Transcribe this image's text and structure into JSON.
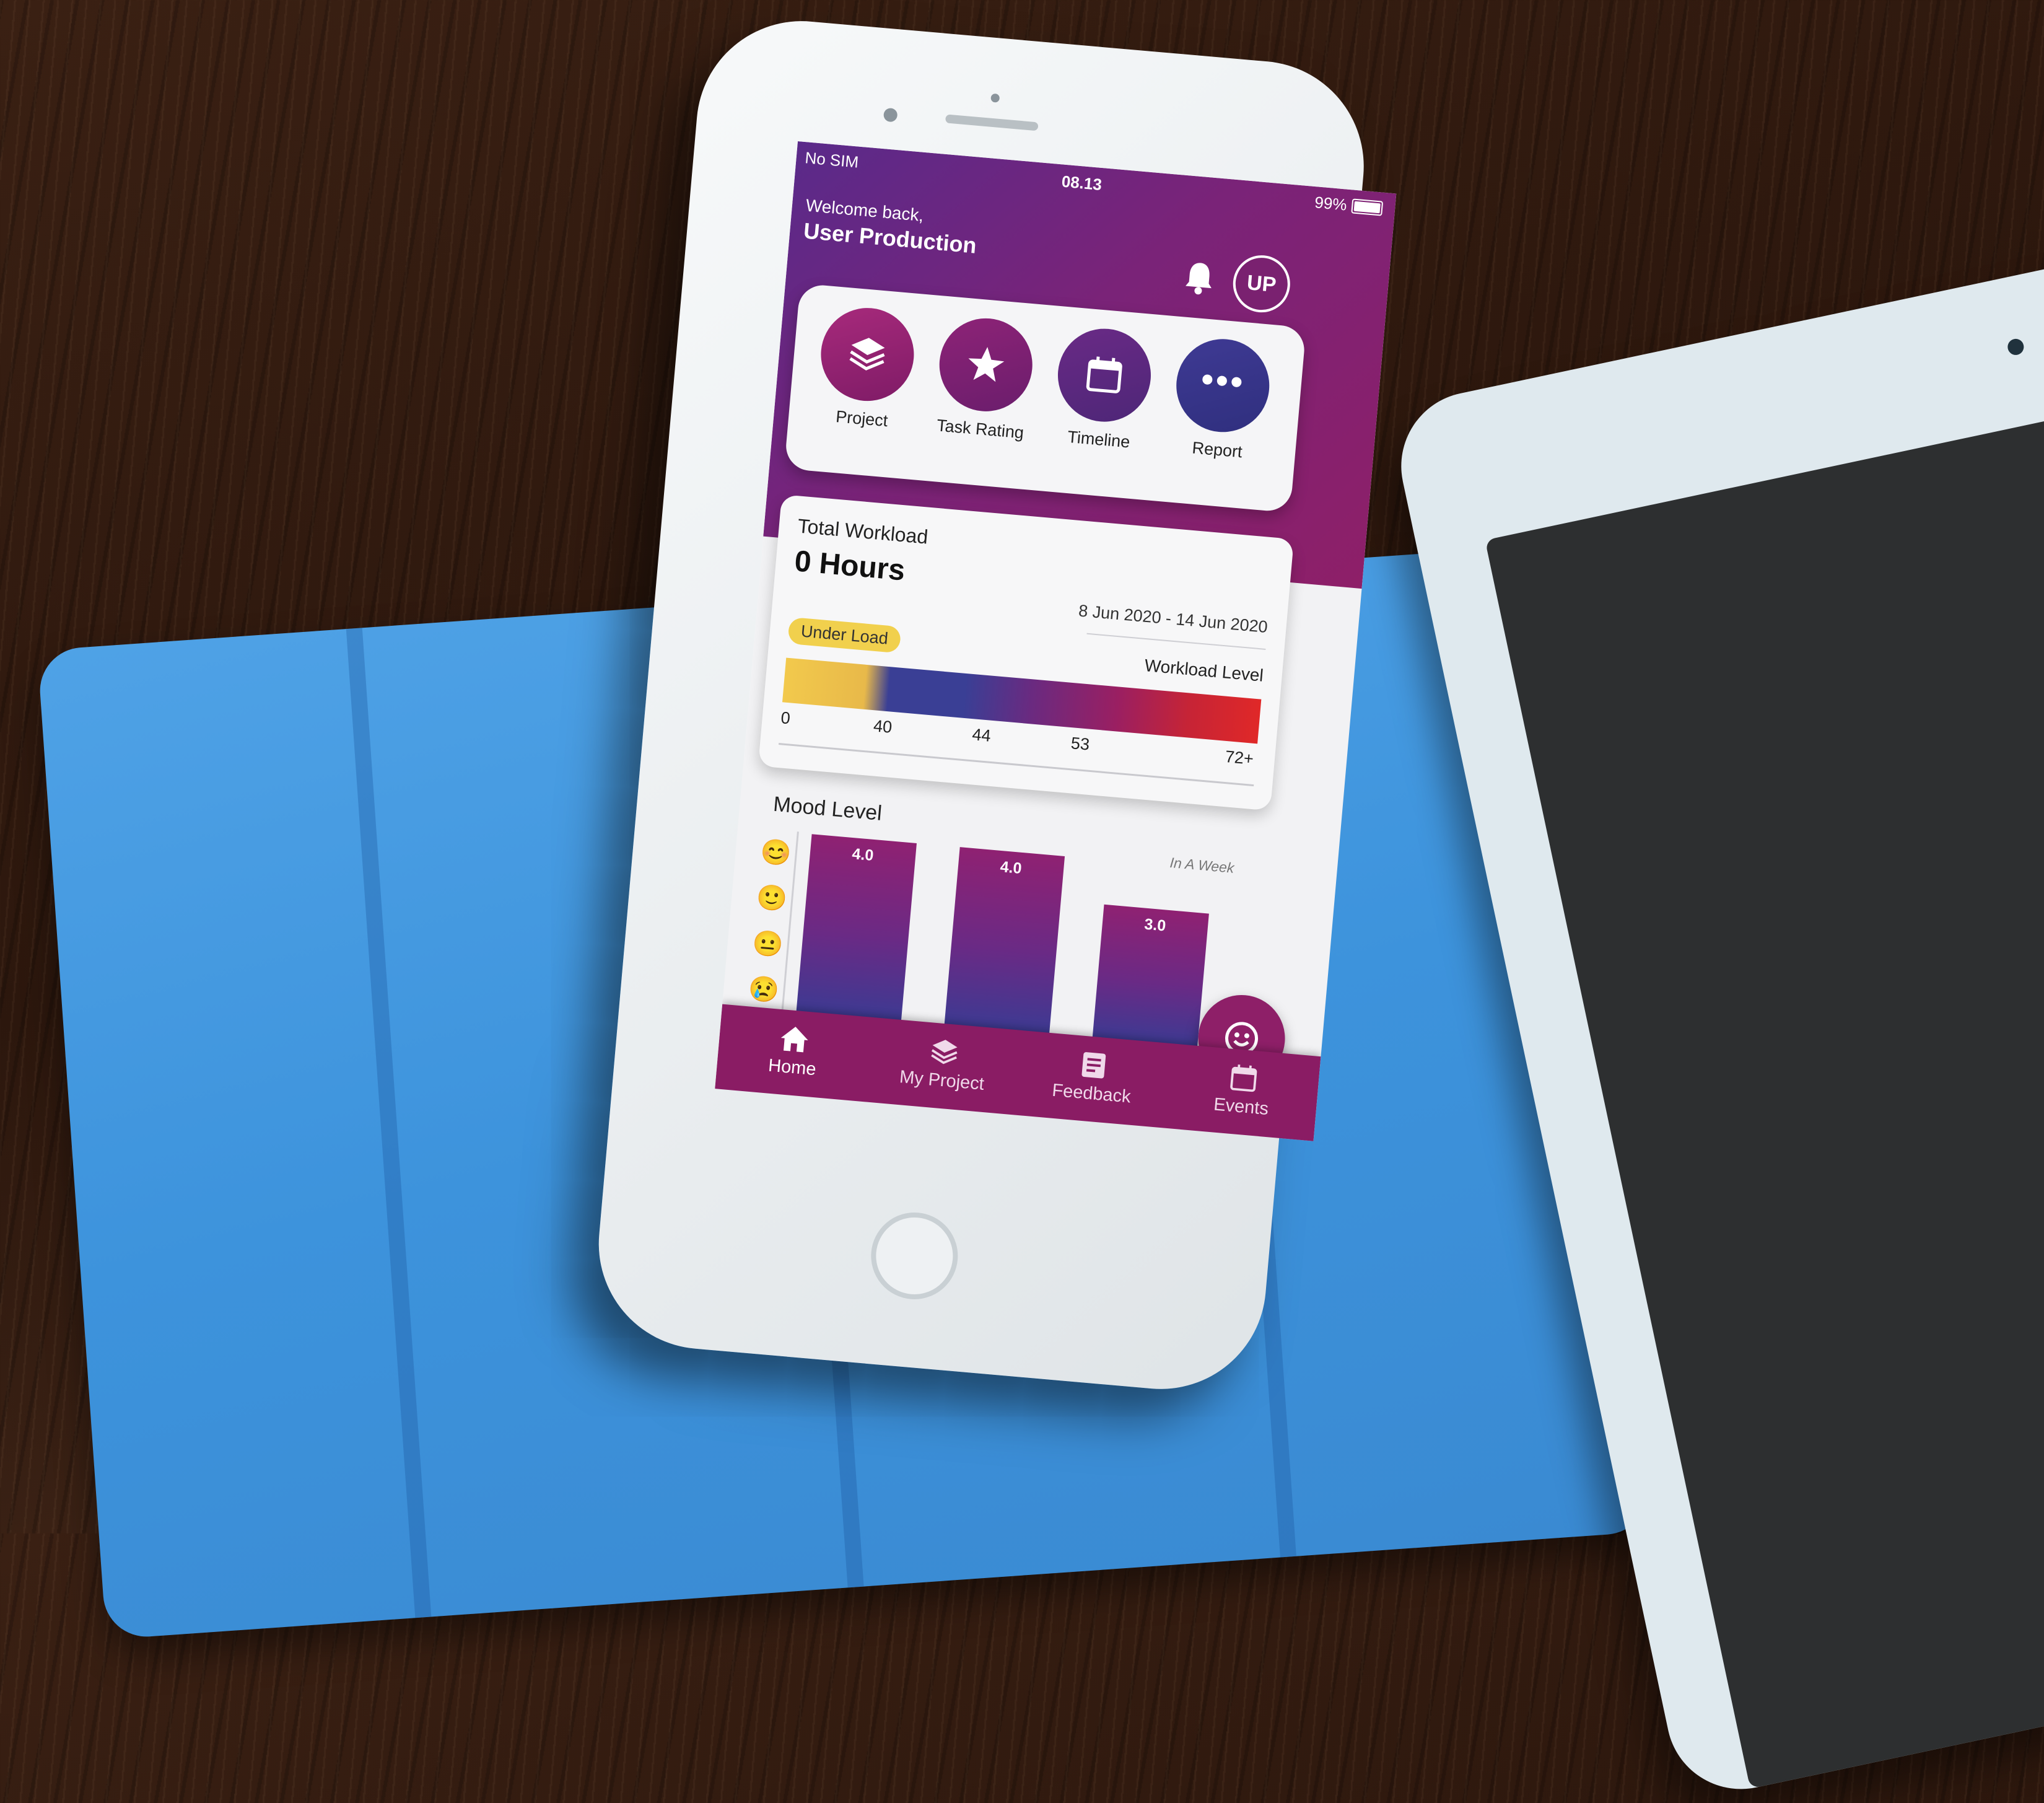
{
  "status_bar": {
    "carrier": "No SIM",
    "time": "08.13",
    "battery": "99%"
  },
  "header": {
    "welcome": "Welcome back,",
    "user_name": "User Production",
    "avatar_initials": "UP"
  },
  "quick_actions": [
    {
      "label": "Project",
      "icon": "layers-icon"
    },
    {
      "label": "Task Rating",
      "icon": "star-icon"
    },
    {
      "label": "Timeline",
      "icon": "calendar-icon"
    },
    {
      "label": "Report",
      "icon": "more-icon"
    }
  ],
  "workload": {
    "title": "Total Workload",
    "hours": "0 Hours",
    "date_range": "8 Jun 2020 - 14 Jun 2020",
    "status_badge": "Under Load",
    "level_label": "Workload Level",
    "ticks": [
      "0",
      "40",
      "44",
      "53",
      "72+"
    ],
    "colors": {
      "under": "#f1d04d",
      "normal": "#3a3f95",
      "high": "#9a1f62",
      "over": "#e02828"
    }
  },
  "mood": {
    "title": "Mood Level",
    "subtitle": "In A Week",
    "emoji_scale": [
      "😊",
      "🙂",
      "😐",
      "😢",
      "😡"
    ]
  },
  "chart_data": {
    "type": "bar",
    "values": [
      4.0,
      4.0,
      3.0
    ],
    "value_labels": [
      "4.0",
      "4.0",
      "3.0"
    ],
    "ylim": [
      0,
      5
    ]
  },
  "bottom_nav": [
    {
      "label": "Home",
      "icon": "home-icon",
      "active": true
    },
    {
      "label": "My Project",
      "icon": "layers-icon",
      "active": false
    },
    {
      "label": "Feedback",
      "icon": "feedback-icon",
      "active": false
    },
    {
      "label": "Events",
      "icon": "calendar-icon",
      "active": false
    }
  ],
  "colors": {
    "brand_purple": "#7a2378",
    "brand_magenta": "#8e1f68",
    "nav_bg": "#8a1c64"
  }
}
